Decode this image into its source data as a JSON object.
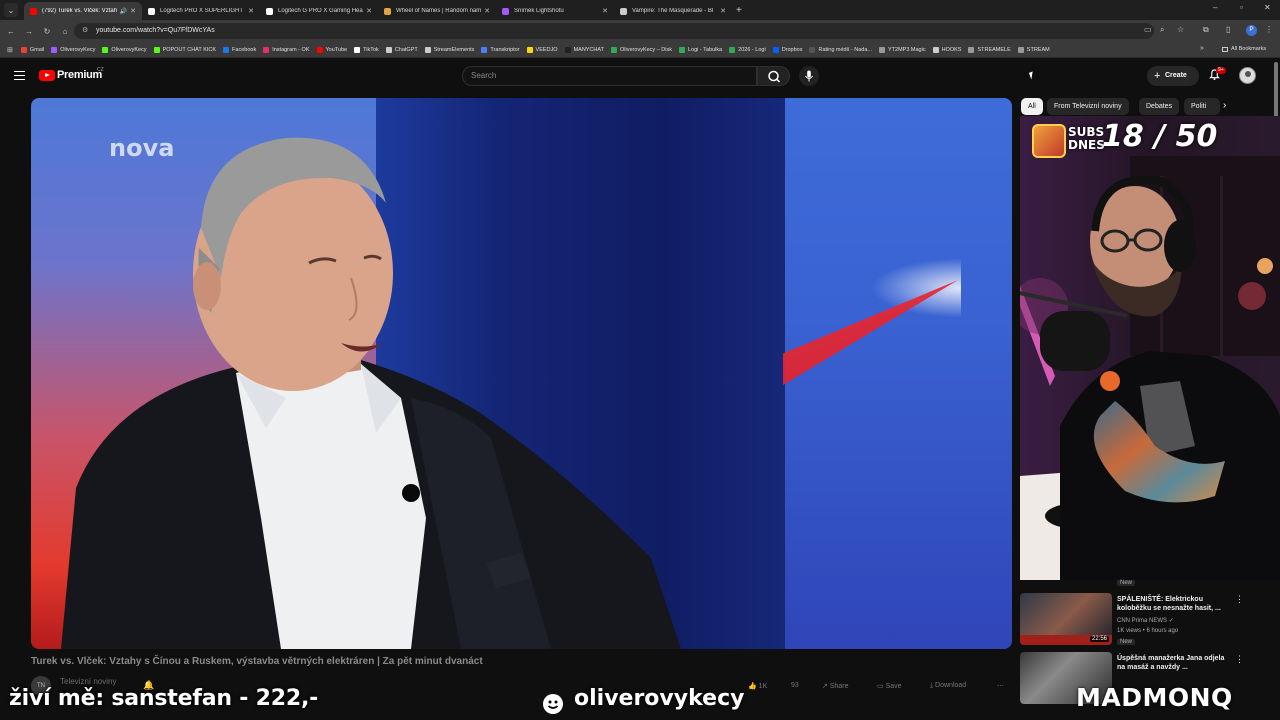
{
  "browser": {
    "tabs": [
      {
        "title": "(792) Turek vs. Vlček: Vztah",
        "active": true,
        "color": "#ff0000",
        "audio": true
      },
      {
        "title": "Logitech PRO X SUPERLIGHT 2",
        "active": false,
        "color": "#ffffff"
      },
      {
        "title": "Logitech G PRO X Gaming Hea",
        "active": false,
        "color": "#ffffff"
      },
      {
        "title": "Wheel of Names | Random nam",
        "active": false,
        "color": "#e6a23c"
      },
      {
        "title": "Snímek Lightshotu",
        "active": false,
        "color": "#a259ff"
      },
      {
        "title": "Vampire: The Masquerade - Bl",
        "active": false,
        "color": "#cccccc"
      }
    ],
    "url": "youtube.com/watch?v=Qu7FfDWcYAs",
    "profile_initial": "P",
    "bookmarks": [
      {
        "label": "Gmail",
        "color": "#ea4335"
      },
      {
        "label": "OliverovyKecy",
        "color": "#a259ff"
      },
      {
        "label": "OliverovyKecy",
        "color": "#53fc18"
      },
      {
        "label": "POPOUT CHAT KICK",
        "color": "#53fc18"
      },
      {
        "label": "Facebook",
        "color": "#1877f2"
      },
      {
        "label": "Instagram - OK",
        "color": "#e1306c"
      },
      {
        "label": "YouTube",
        "color": "#ff0000"
      },
      {
        "label": "TikTok",
        "color": "#ffffff"
      },
      {
        "label": "ChatGPT",
        "color": "#cccccc"
      },
      {
        "label": "StreamElements",
        "color": "#cccccc"
      },
      {
        "label": "Transkriptor",
        "color": "#4f7cff"
      },
      {
        "label": "VEEDJO",
        "color": "#f5d90a"
      },
      {
        "label": "MANYCHAT",
        "color": "#222222"
      },
      {
        "label": "OliverovyKecy – Disk",
        "color": "#34a853"
      },
      {
        "label": "Logi - Tabulka",
        "color": "#34a853"
      },
      {
        "label": "2026 - Logi",
        "color": "#34a853"
      },
      {
        "label": "Dropbox",
        "color": "#0061ff"
      },
      {
        "label": "Rating médií - Nada...",
        "color": "#555555"
      },
      {
        "label": "YT2MP3 Magic",
        "color": "#999999"
      },
      {
        "label": "HOOKS",
        "color": "#cccccc"
      },
      {
        "label": "STREAMELE",
        "color": "#999999"
      },
      {
        "label": "STREAM",
        "color": "#999999"
      }
    ],
    "all_bookmarks": "All Bookmarks"
  },
  "youtube": {
    "logo_text": "Premium",
    "country": "CZ",
    "search_placeholder": "Search",
    "create_label": "Create",
    "notif_count": "9+"
  },
  "video": {
    "title": "Turek vs. Vlček: Vztahy s Čínou a Ruskem, výstavba větrných elektráren | Za pět minut dvanáct",
    "channel": "Televizní noviny",
    "channel_initials": "TN",
    "likes": "1K",
    "comments": "93",
    "share": "Share",
    "save": "Save",
    "download": "Download",
    "watermark": "nova"
  },
  "chips": [
    "All",
    "From Televizní noviny",
    "Debates",
    "Politi"
  ],
  "webcam": {
    "subs_label": "SUBS\nDNES",
    "subs_count": "18 / 50"
  },
  "recommended": [
    {
      "badge": "New",
      "title": "SPÁLENIŠTĚ: Elektrickou koloběžku se nesnažte hasit, ...",
      "channel": "CNN Prima NEWS",
      "meta": "1K views • 6 hours ago",
      "tag": "New",
      "duration": "22:56"
    },
    {
      "title": "Úspěšná manažerka Jana odjela na masáž a navždy ...",
      "channel": ""
    }
  ],
  "overlays": {
    "left": "živí mě: sanstefan - 222,-",
    "middle": "oliverovykecy",
    "right": "MADMONQ"
  }
}
